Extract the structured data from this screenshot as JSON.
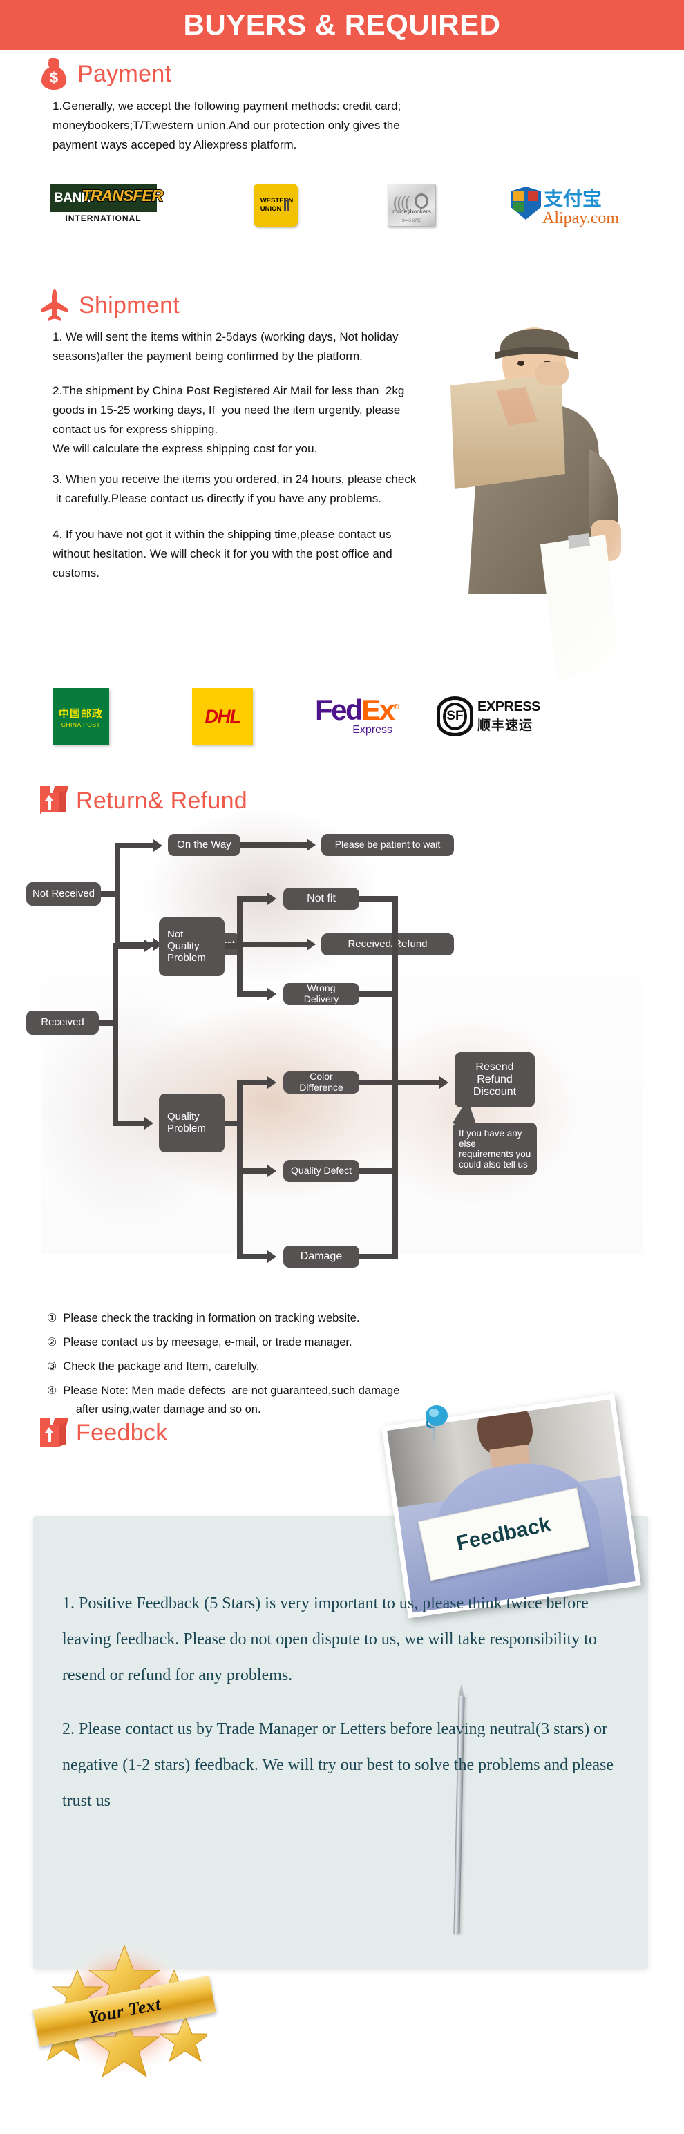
{
  "header": {
    "title": "BUYERS & REQUIRED",
    "bg_color": "#F05A4B",
    "text_color": "#FFFFFF"
  },
  "theme": {
    "accent": "#F05A4B",
    "node_gray": "#565252",
    "feedback_panel_bg": "#E3ECEB",
    "feedback_text_color": "#1C4654"
  },
  "sections": {
    "payment": {
      "icon": "money-bag-icon",
      "title": "Payment",
      "paragraph": "1.Generally, we accept the following payment methods: credit card;\nmoneybookers;T/T;western union.And our protection only gives the\npayment ways acceped by Aliexpress platform.",
      "logos": [
        {
          "name": "bank-transfer",
          "line1": "BANK",
          "line2": "TRANSFER",
          "line3": "INTERNATIONAL"
        },
        {
          "name": "western-union",
          "line1": "WESTERN",
          "line2": "UNION"
        },
        {
          "name": "moneybookers",
          "line1": "moneybookers",
          "line2": "3445 8793"
        },
        {
          "name": "alipay",
          "line1": "支付宝",
          "line2": "Alipay.com"
        }
      ]
    },
    "shipment": {
      "icon": "airplane-icon",
      "title": "Shipment",
      "paragraphs": [
        "1. We will sent the items within 2-5days (working days, Not holiday\nseasons)after the payment being confirmed by the platform.",
        "2.The shipment by China Post Registered Air Mail for less than  2kg\ngoods in 15-25 working days, If  you need the item urgently, please\ncontact us for express shipping.\nWe will calculate the express shipping cost for you.",
        "3. When you receive the items you ordered, in 24 hours, please check\n it carefully.Please contact us directly if you have any problems.",
        "4. If you have not got it within the shipping time,please contact us\nwithout hesitation. We will check it for you with the post office and\ncustoms."
      ],
      "couriers": [
        {
          "name": "china-post",
          "zh": "中国邮政",
          "en": "CHINA POST"
        },
        {
          "name": "dhl",
          "text": "DHL"
        },
        {
          "name": "fedex",
          "part1": "Fed",
          "part2": "Ex",
          "sub": "Express",
          "reg": "®"
        },
        {
          "name": "sf-express",
          "badge": "SF",
          "en": "EXPRESS",
          "zh": "顺丰速运"
        }
      ]
    },
    "return_refund": {
      "icon": "parcel-box-icon",
      "title": "Return& Refund",
      "flowchart": {
        "nodes": {
          "not_received": "Not Received",
          "on_the_way": "On the Way",
          "please_wait": "Please be patient to wait",
          "received_lost": "Received/Lost",
          "received_refund": "Received/Refund",
          "received": "Received",
          "not_quality_problem": "Not\nQuality\nProblem",
          "quality_problem": "Quality\nProblem",
          "not_fit": "Not fit",
          "wrong_delivery": "Wrong Delivery",
          "color_difference": "Color Difference",
          "quality_defect": "Quality Defect",
          "damage": "Damage",
          "resend_refund_discount": "Resend\nRefund\nDiscount",
          "callout": "If you have any else\nrequirements you\ncould also tell us"
        }
      },
      "notes": [
        {
          "marker": "①",
          "text": "Please check the tracking in formation on tracking website."
        },
        {
          "marker": "②",
          "text": "Please contact us by meesage, e-mail, or trade manager."
        },
        {
          "marker": "③",
          "text": "Check the package and Item, carefully."
        },
        {
          "marker": "④",
          "text": "Please Note: Men made defects  are not guaranteed,such damage\n    after using,water damage and so on."
        }
      ]
    },
    "feedback": {
      "icon": "parcel-box-icon",
      "title": "Feedbck",
      "photo_sign_text": "Feedback",
      "paragraphs": [
        "1. Positive Feedback (5 Stars) is very important to us, please think twice before leaving feedback. Please do not open dispute to us,   we will take responsibility to resend or refund for any problems.",
        "2. Please contact us by Trade Manager or Letters before leaving neutral(3 stars) or negative (1-2 stars) feedback. We will try our best to solve the problems and please trust us"
      ],
      "badge_text": "Your Text"
    }
  }
}
